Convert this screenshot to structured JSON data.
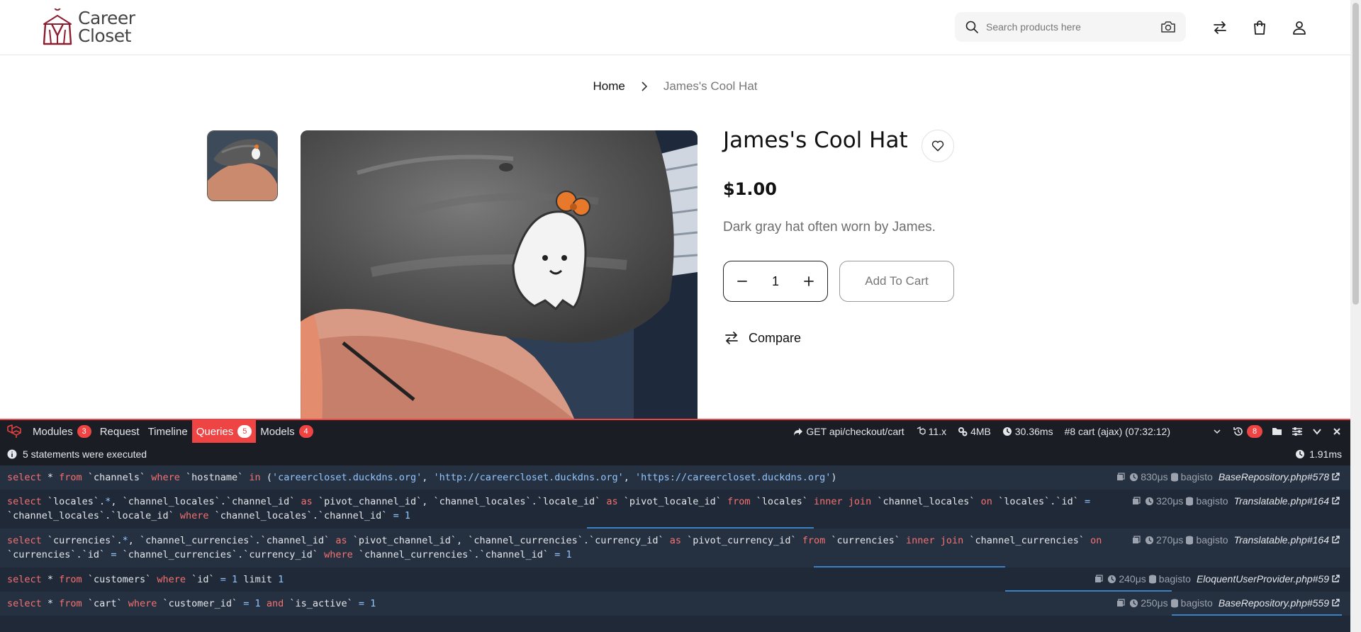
{
  "header": {
    "logo_line1": "Career",
    "logo_line2": "Closet",
    "search_placeholder": "Search products here"
  },
  "breadcrumb": {
    "home": "Home",
    "current": "James's Cool Hat"
  },
  "product": {
    "title": "James's Cool Hat",
    "price": "$1.00",
    "description": "Dark gray hat often worn by James.",
    "quantity": "1",
    "add_to_cart": "Add To Cart",
    "compare": "Compare"
  },
  "debugbar": {
    "tabs": [
      {
        "label": "Modules",
        "badge": "3"
      },
      {
        "label": "Request",
        "badge": ""
      },
      {
        "label": "Timeline",
        "badge": ""
      },
      {
        "label": "Queries",
        "badge": "5"
      },
      {
        "label": "Models",
        "badge": "4"
      }
    ],
    "route": "GET api/checkout/cart",
    "version": "11.x",
    "memory": "4MB",
    "time": "30.36ms",
    "request_select": "#8 cart (ajax) (07:32:12)",
    "history_count": "8",
    "status_text": "5 statements were executed",
    "total_duration": "1.91ms",
    "queries": [
      {
        "duration": "830μs",
        "connection": "bagisto",
        "source": "BaseRepository.php#578"
      },
      {
        "duration": "320μs",
        "connection": "bagisto",
        "source": "Translatable.php#164"
      },
      {
        "duration": "270μs",
        "connection": "bagisto",
        "source": "Translatable.php#164"
      },
      {
        "duration": "240μs",
        "connection": "bagisto",
        "source": "EloquentUserProvider.php#59"
      },
      {
        "duration": "250μs",
        "connection": "bagisto",
        "source": "BaseRepository.php#559"
      }
    ],
    "sql": {
      "q1": {
        "t1": "select",
        "t2": " * ",
        "t3": "from",
        "t4": " `channels` ",
        "t5": "where",
        "t6": " `hostname` ",
        "t7": "in",
        "t8": " (",
        "t9": "'careercloset.duckdns.org'",
        "t10": ", ",
        "t11": "'http://careercloset.duckdns.org'",
        "t12": ", ",
        "t13": "'https://careercloset.duckdns.org'",
        "t14": ")"
      },
      "q2a": {
        "t1": "select",
        "t2": " `locales`.",
        "t3": "*",
        "t4": ", `channel_locales`.`channel_id` ",
        "t5": "as",
        "t6": " `pivot_channel_id`, `channel_locales`.`locale_id` ",
        "t7": "as",
        "t8": " `pivot_locale_id` ",
        "t9": "from",
        "t10": " `locales` ",
        "t11": "inner join",
        "t12": " `channel_locales` ",
        "t13": "on",
        "t14": " `locales`.`id` ",
        "t15": "="
      },
      "q2b": {
        "t1": "`channel_locales`.`locale_id` ",
        "t2": "where",
        "t3": " `channel_locales`.`channel_id` ",
        "t4": "=",
        "t5": " 1"
      },
      "q3a": {
        "t1": "select",
        "t2": " `currencies`.",
        "t3": "*",
        "t4": ", `channel_currencies`.`channel_id` ",
        "t5": "as",
        "t6": " `pivot_channel_id`, `channel_currencies`.`currency_id` ",
        "t7": "as",
        "t8": " `pivot_currency_id` ",
        "t9": "from",
        "t10": " `currencies` ",
        "t11": "inner join",
        "t12": " `channel_currencies` ",
        "t13": "on"
      },
      "q3b": {
        "t1": "`currencies`.`id` ",
        "t2": "=",
        "t3": " `channel_currencies`.`currency_id` ",
        "t4": "where",
        "t5": " `channel_currencies`.`channel_id` ",
        "t6": "=",
        "t7": " 1"
      },
      "q4": {
        "t1": "select",
        "t2": " * ",
        "t3": "from",
        "t4": " `customers` ",
        "t5": "where",
        "t6": " `id` ",
        "t7": "=",
        "t8": " 1 ",
        "t9": "limit",
        "t10": " 1"
      },
      "q5": {
        "t1": "select",
        "t2": " * ",
        "t3": "from",
        "t4": " `cart` ",
        "t5": "where",
        "t6": " `customer_id` ",
        "t7": "=",
        "t8": " 1 ",
        "t9": "and",
        "t10": " `is_active` ",
        "t11": "=",
        "t12": " 1"
      }
    }
  },
  "colors": {
    "debug_accent": "#ef4444",
    "debug_bg": "#1f2937",
    "sql_keyword": "#f87171",
    "sql_string": "#93c5fd"
  }
}
